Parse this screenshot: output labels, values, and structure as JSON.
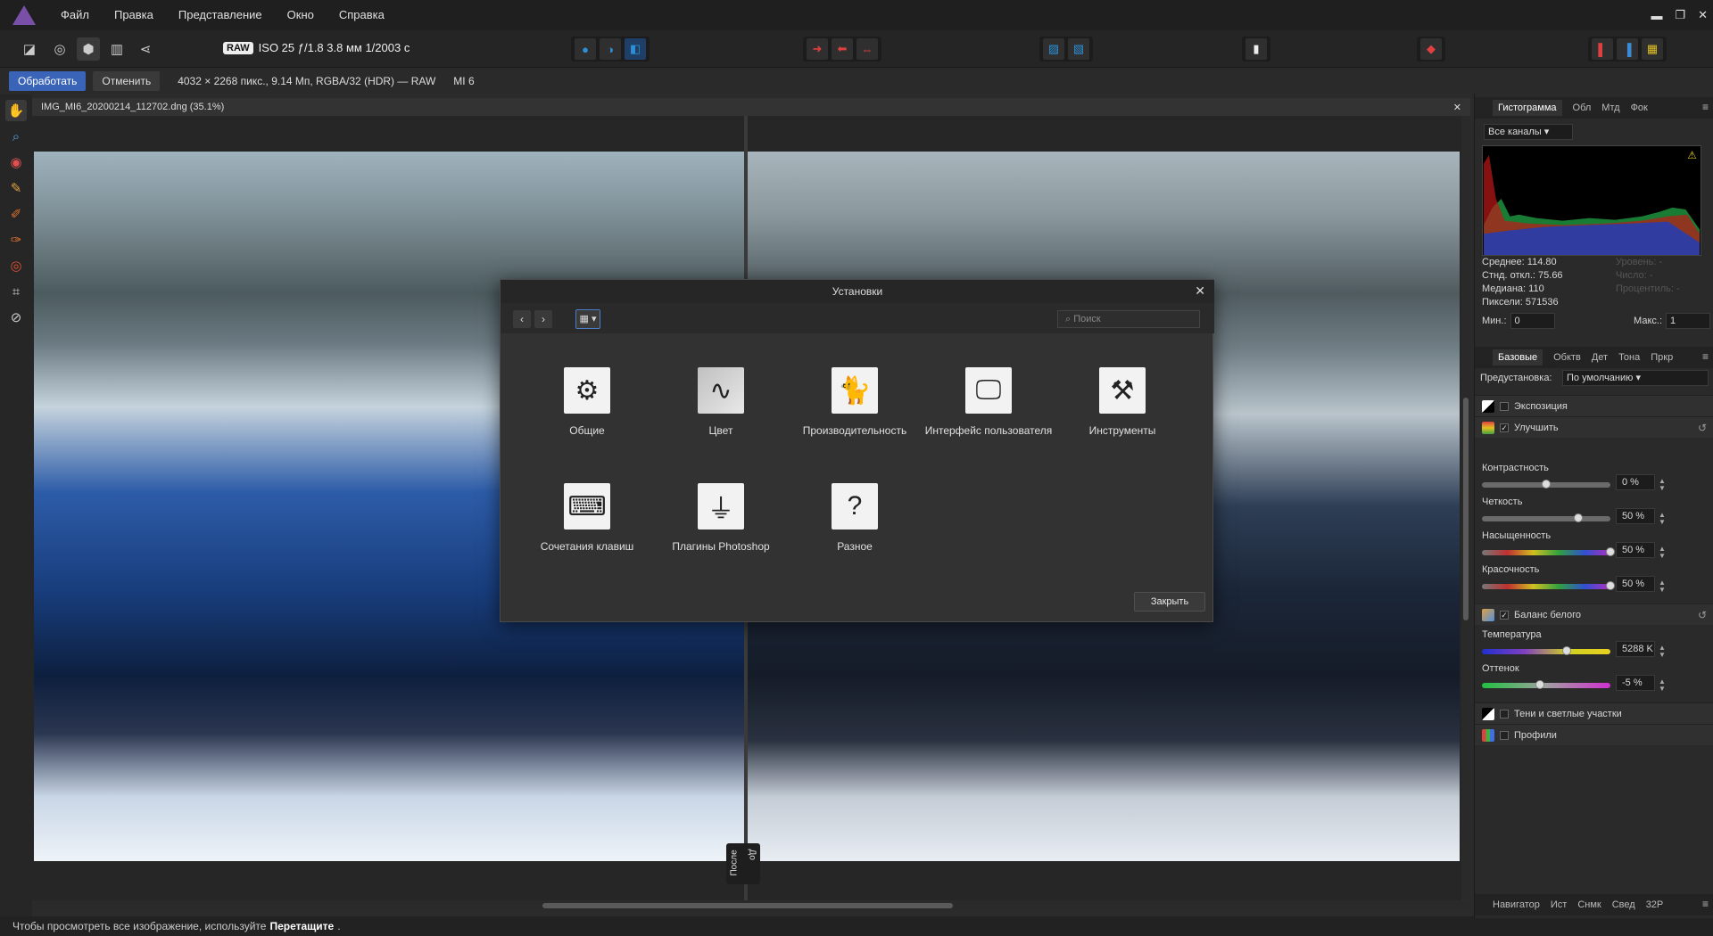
{
  "menu": [
    "Файл",
    "Правка",
    "Представление",
    "Окно",
    "Справка"
  ],
  "toolbar": {
    "raw_badge": "RAW",
    "raw_info": "ISO 25 ƒ/1.8 3.8 мм 1/2003 с"
  },
  "context": {
    "develop": "Обработать",
    "cancel": "Отменить",
    "info": "4032 × 2268 пикс., 9.14 Мп, RGBA/32 (HDR) — RAW",
    "camera": "MI 6"
  },
  "document": {
    "tab": "IMG_MI6_20200214_112702.dng (35.1%)",
    "split_after": "После",
    "split_before": "До"
  },
  "status": {
    "text": "Чтобы просмотреть все изображение, используйте",
    "bold": "Перетащите",
    "end": "."
  },
  "hist_tabs": [
    "Гистограмма",
    "Обл",
    "Мтд",
    "Фок"
  ],
  "histogram": {
    "channel": "Все каналы",
    "mean": "Среднее: 114.80",
    "std": "Стнд. откл.: 75.66",
    "median": "Медиана: 110",
    "pixels": "Пиксели: 571536",
    "level": "Уровень: -",
    "count": "Число: -",
    "percentile": "Процентиль: -",
    "min_label": "Мин.:",
    "min": "0",
    "max_label": "Макс.:",
    "max": "1"
  },
  "adj_tabs": [
    "Базовые",
    "Обктв",
    "Дет",
    "Тона",
    "Пркр"
  ],
  "preset": {
    "label": "Предустановка:",
    "value": "По умолчанию"
  },
  "sections": {
    "exposure": "Экспозиция",
    "enhance": "Улучшить",
    "wb": "Баланс белого",
    "shadows": "Тени и светлые участки",
    "profiles": "Профили"
  },
  "sliders": {
    "contrast": {
      "label": "Контрастность",
      "value": "0 %",
      "level": 0.5
    },
    "clarity": {
      "label": "Четкость",
      "value": "50 %",
      "level": 0.75
    },
    "saturation": {
      "label": "Насыщенность",
      "value": "50 %",
      "level": 1.0
    },
    "vibrance": {
      "label": "Красочность",
      "value": "50 %",
      "level": 1.0
    },
    "temperature": {
      "label": "Температура",
      "value": "5288 K",
      "level": 0.66
    },
    "tint": {
      "label": "Оттенок",
      "value": "-5 %",
      "level": 0.45
    }
  },
  "bottom_tabs": [
    "Навигатор",
    "Ист",
    "Снмк",
    "Свед",
    "32Р"
  ],
  "dialog": {
    "title": "Установки",
    "search": "Поиск",
    "close": "Закрыть",
    "items": [
      "Общие",
      "Цвет",
      "Производительность",
      "Интерфейс пользователя",
      "Инструменты",
      "Сочетания клавиш",
      "Плагины Photoshop",
      "Разное"
    ]
  },
  "colors": {
    "accent": "#3a64b8",
    "panel": "#2a2a2a",
    "dialog": "#323232"
  }
}
